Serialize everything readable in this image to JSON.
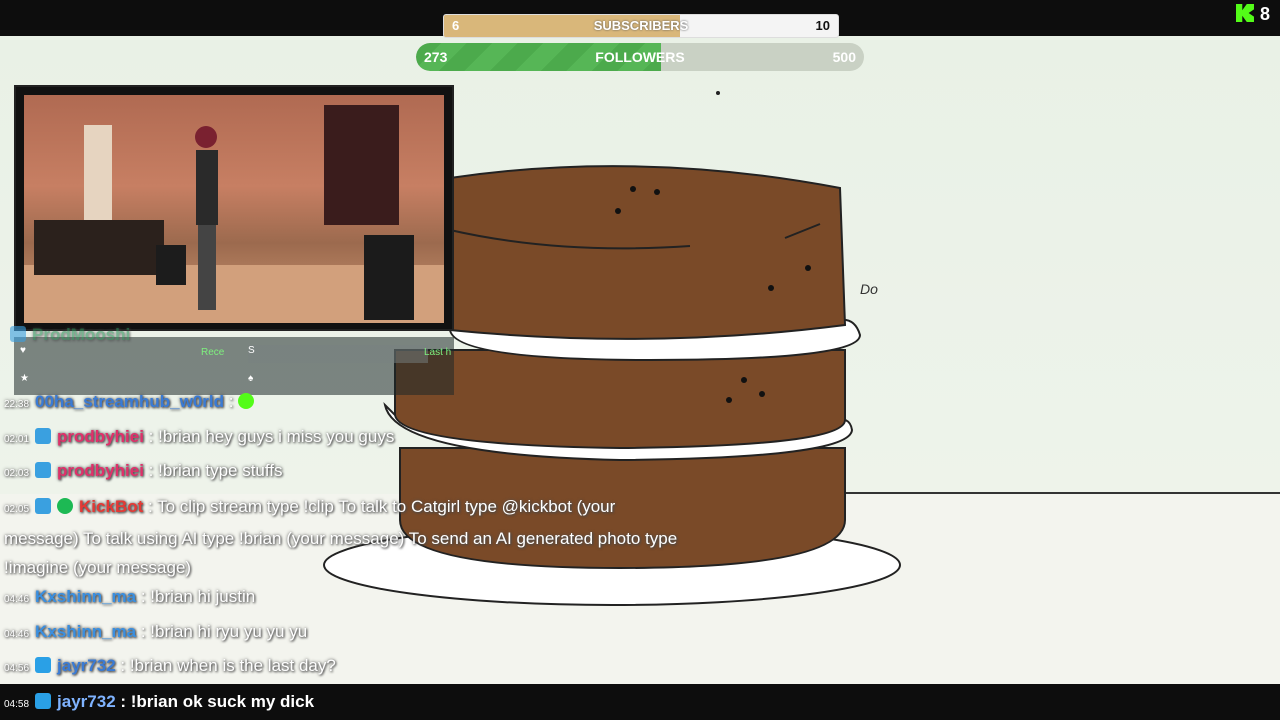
{
  "goals": {
    "subscribers": {
      "label": "SUBSCRIBERS",
      "current": "6",
      "target": "10",
      "progress": 0.6
    },
    "followers": {
      "label": "FOLLOWERS",
      "current": "273",
      "target": "500",
      "progress": 0.546
    }
  },
  "kick": {
    "viewer_count": "8",
    "icon": "kick-logo-icon"
  },
  "drawing": {
    "scribble": "Do"
  },
  "widget": {
    "left_label": "Rece",
    "mid_label": "S",
    "right_label": "Last h"
  },
  "chat": {
    "messages": [
      {
        "time": "",
        "user": "ProdMooshi",
        "text": "",
        "color": "#2e8b57"
      },
      {
        "time": "22:38",
        "user": "00ha_streamhub_w0rld",
        "text": " :",
        "color": "#3a7bd5"
      },
      {
        "time": "02:01",
        "user": "prodbyhiei",
        "text": " : !brian hey guys i miss you guys",
        "color": "#e0306a"
      },
      {
        "time": "02:03",
        "user": "prodbyhiei",
        "text": " : !brian type stuffs",
        "color": "#e0306a"
      },
      {
        "time": "02:05",
        "user": "KickBot",
        "text": " : To clip stream type !clip To talk to Catgirl type @kickbot (your message) To talk using AI type !brian (your message) To send an AI generated photo type !imagine (your message)",
        "color": "#e53935"
      },
      {
        "time": "04:46",
        "user": "Kxshinn_ma",
        "text": " : !brian hi justin",
        "color": "#3a8fe0"
      },
      {
        "time": "04:46",
        "user": "Kxshinn_ma",
        "text": " : !brian hi ryu yu yu yu",
        "color": "#3a8fe0"
      },
      {
        "time": "04:56",
        "user": "jayr732",
        "text": " : !brian when is the last day?",
        "color": "#3a7bd5"
      }
    ],
    "last": {
      "time": "04:58",
      "user": "jayr732",
      "text": " : !brian ok suck my dick"
    }
  }
}
